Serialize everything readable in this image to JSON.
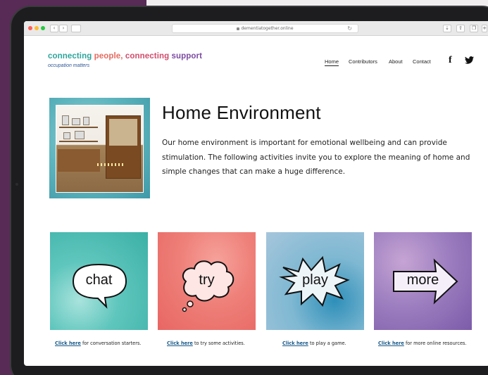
{
  "browser": {
    "url": "dementiatogether.online",
    "nav_back": "‹",
    "nav_forward": "›"
  },
  "site": {
    "brand_words": [
      "connecting",
      "people,",
      "connecting",
      "support"
    ],
    "tagline": "occupation matters",
    "nav": [
      "Home",
      "Contributors",
      "About",
      "Contact"
    ],
    "active_nav": "Home",
    "social": [
      "facebook-icon",
      "twitter-icon"
    ]
  },
  "hero": {
    "title": "Home Environment",
    "body": "Our home environment is important for emotional wellbeing and can provide stimulation. The following activities invite you to explore the meaning of home and simple changes that can make a huge difference."
  },
  "tiles": [
    {
      "label": "chat",
      "link": "Click here",
      "caption": " for conversation starters.",
      "color": "#5fc6bd"
    },
    {
      "label": "try",
      "link": "Click here",
      "caption": " to try some activities.",
      "color": "#ee7f78"
    },
    {
      "label": "play",
      "link": "Click here",
      "caption": " to play a game.",
      "color": "#7fb8d2"
    },
    {
      "label": "more",
      "link": "Click here",
      "caption": " for more online resources.",
      "color": "#9e7fc0"
    }
  ]
}
